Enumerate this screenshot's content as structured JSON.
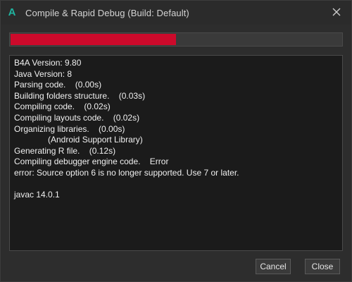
{
  "window": {
    "title": "Compile & Rapid Debug (Build: Default)",
    "app_icon_glyph": "A",
    "icon": "b4a-icon",
    "close_icon": "close-icon"
  },
  "progress": {
    "fraction": 0.5,
    "color": "#cc0a2b"
  },
  "log": {
    "lines": [
      "B4A Version: 9.80",
      "Java Version: 8",
      "Parsing code.    (0.00s)",
      "Building folders structure.    (0.03s)",
      "Compiling code.    (0.02s)",
      "Compiling layouts code.    (0.02s)",
      "Organizing libraries.    (0.00s)",
      "(Android Support Library)",
      "Generating R file.    (0.12s)",
      "Compiling debugger engine code.    Error",
      "error: Source option 6 is no longer supported. Use 7 or later.",
      "",
      "javac 14.0.1"
    ]
  },
  "buttons": {
    "cancel_label": "Cancel",
    "close_label": "Close"
  }
}
